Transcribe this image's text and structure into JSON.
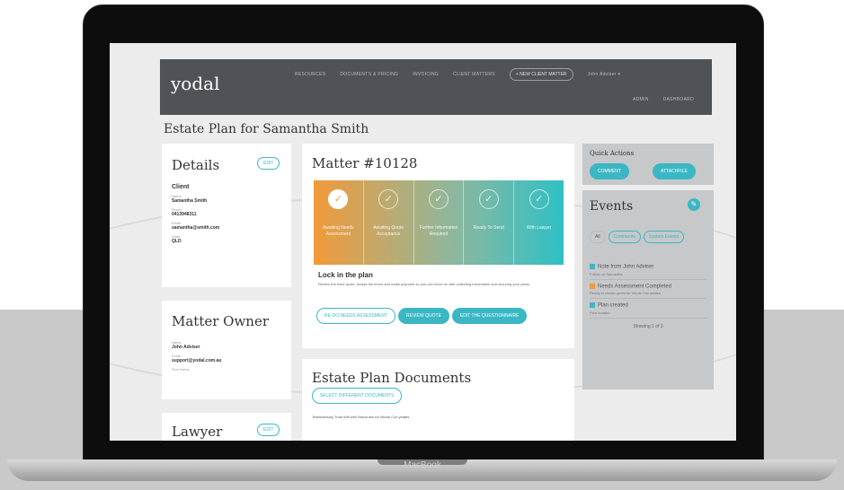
{
  "device": {
    "brand": "MacBook"
  },
  "nav": {
    "logo": "yodal",
    "links": [
      "RESOURCES",
      "DOCUMENTS & PRICING",
      "INVOICING",
      "CLIENT MATTERS"
    ],
    "new_matter_button": "+ NEW CLIENT MATTER",
    "user_menu": "John Adviser ▾",
    "sub_links": [
      "ADMIN",
      "DASHBOARD"
    ]
  },
  "page": {
    "title": "Estate Plan for Samantha Smith"
  },
  "details": {
    "title": "Details",
    "edit": "EDIT",
    "section": "Client",
    "fields": [
      {
        "label": "Name",
        "value": "Samantha Smith"
      },
      {
        "label": "Phone",
        "value": "0413948311"
      },
      {
        "label": "Email",
        "value": "samantha@smith.com"
      },
      {
        "label": "State",
        "value": "QLD"
      }
    ]
  },
  "owner": {
    "title": "Matter Owner",
    "fields": [
      {
        "label": "Name",
        "value": "John Adviser"
      },
      {
        "label": "Email",
        "value": "support@yodal.com.au"
      },
      {
        "label": "Firm Name",
        "value": ""
      }
    ]
  },
  "lawyer": {
    "title": "Lawyer",
    "edit": "EDIT"
  },
  "matter": {
    "title": "Matter #10128",
    "steps": [
      {
        "label": "Awaiting Needs Assessment",
        "done": true
      },
      {
        "label": "Awaiting Quote Acceptance",
        "done": false
      },
      {
        "label": "Further Information Required",
        "done": false
      },
      {
        "label": "Ready To Send",
        "done": false
      },
      {
        "label": "With Lawyer",
        "done": false
      }
    ],
    "lock_title": "Lock in the plan",
    "lock_text": "Review the fixed quote, accept the terms and make payment so you can move on with collecting information and securing your plans.",
    "btn_redo": "RE-DO NEEDS ASSESSMENT",
    "btn_review": "REVIEW QUOTE",
    "btn_edit": "EDIT THE QUESTIONNAIRE"
  },
  "documents": {
    "title": "Estate Plan Documents",
    "select_button": "SELECT DIFFERENT DOCUMENTS",
    "item": "Testamentary Trust Will with Structures for Nicole Cox yeates"
  },
  "quick_actions": {
    "title": "Quick Actions",
    "comment": "COMMENT",
    "attachfile": "ATTACHFILE"
  },
  "events": {
    "title": "Events",
    "filters": [
      "All",
      "Comments",
      "System Events"
    ],
    "items": [
      {
        "title": "Note from John Adviser",
        "sub": "Follow up Samantha"
      },
      {
        "title": "Needs Assessment Completed",
        "sub": "Ready to review quote for Nicole Cox yeates"
      },
      {
        "title": "Plan created",
        "sub": "Plan created"
      }
    ],
    "footer": "Showing 1 of 3"
  },
  "colors": {
    "accent": "#3bb7c4",
    "orange": "#f29a3a",
    "nav": "#4f5357"
  }
}
